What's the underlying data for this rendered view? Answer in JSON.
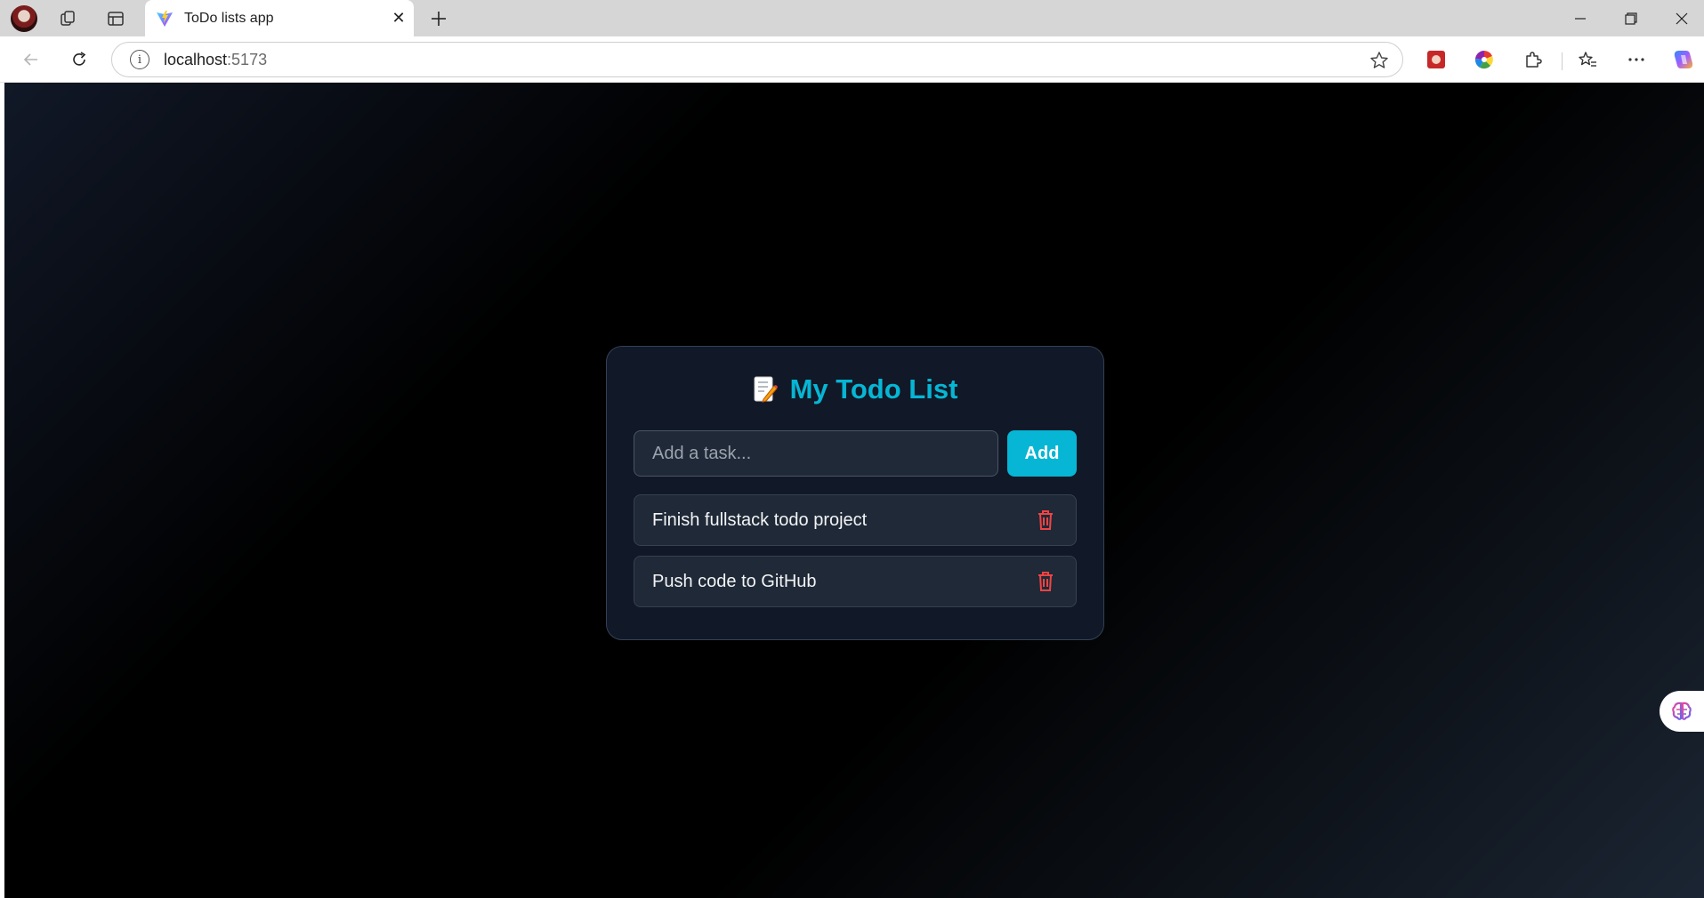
{
  "browser": {
    "tab": {
      "title": "ToDo lists app"
    },
    "address": {
      "host": "localhost",
      "port": ":5173"
    }
  },
  "app": {
    "title": "My Todo List",
    "title_icon": "memo-icon",
    "input": {
      "placeholder": "Add a task...",
      "value": ""
    },
    "add_button": "Add",
    "todos": [
      {
        "text": "Finish fullstack todo project"
      },
      {
        "text": "Push code to GitHub"
      }
    ]
  },
  "colors": {
    "accent": "#06b6d4",
    "card_bg": "#111827",
    "item_bg": "#1f2937",
    "delete": "#ef4444"
  }
}
